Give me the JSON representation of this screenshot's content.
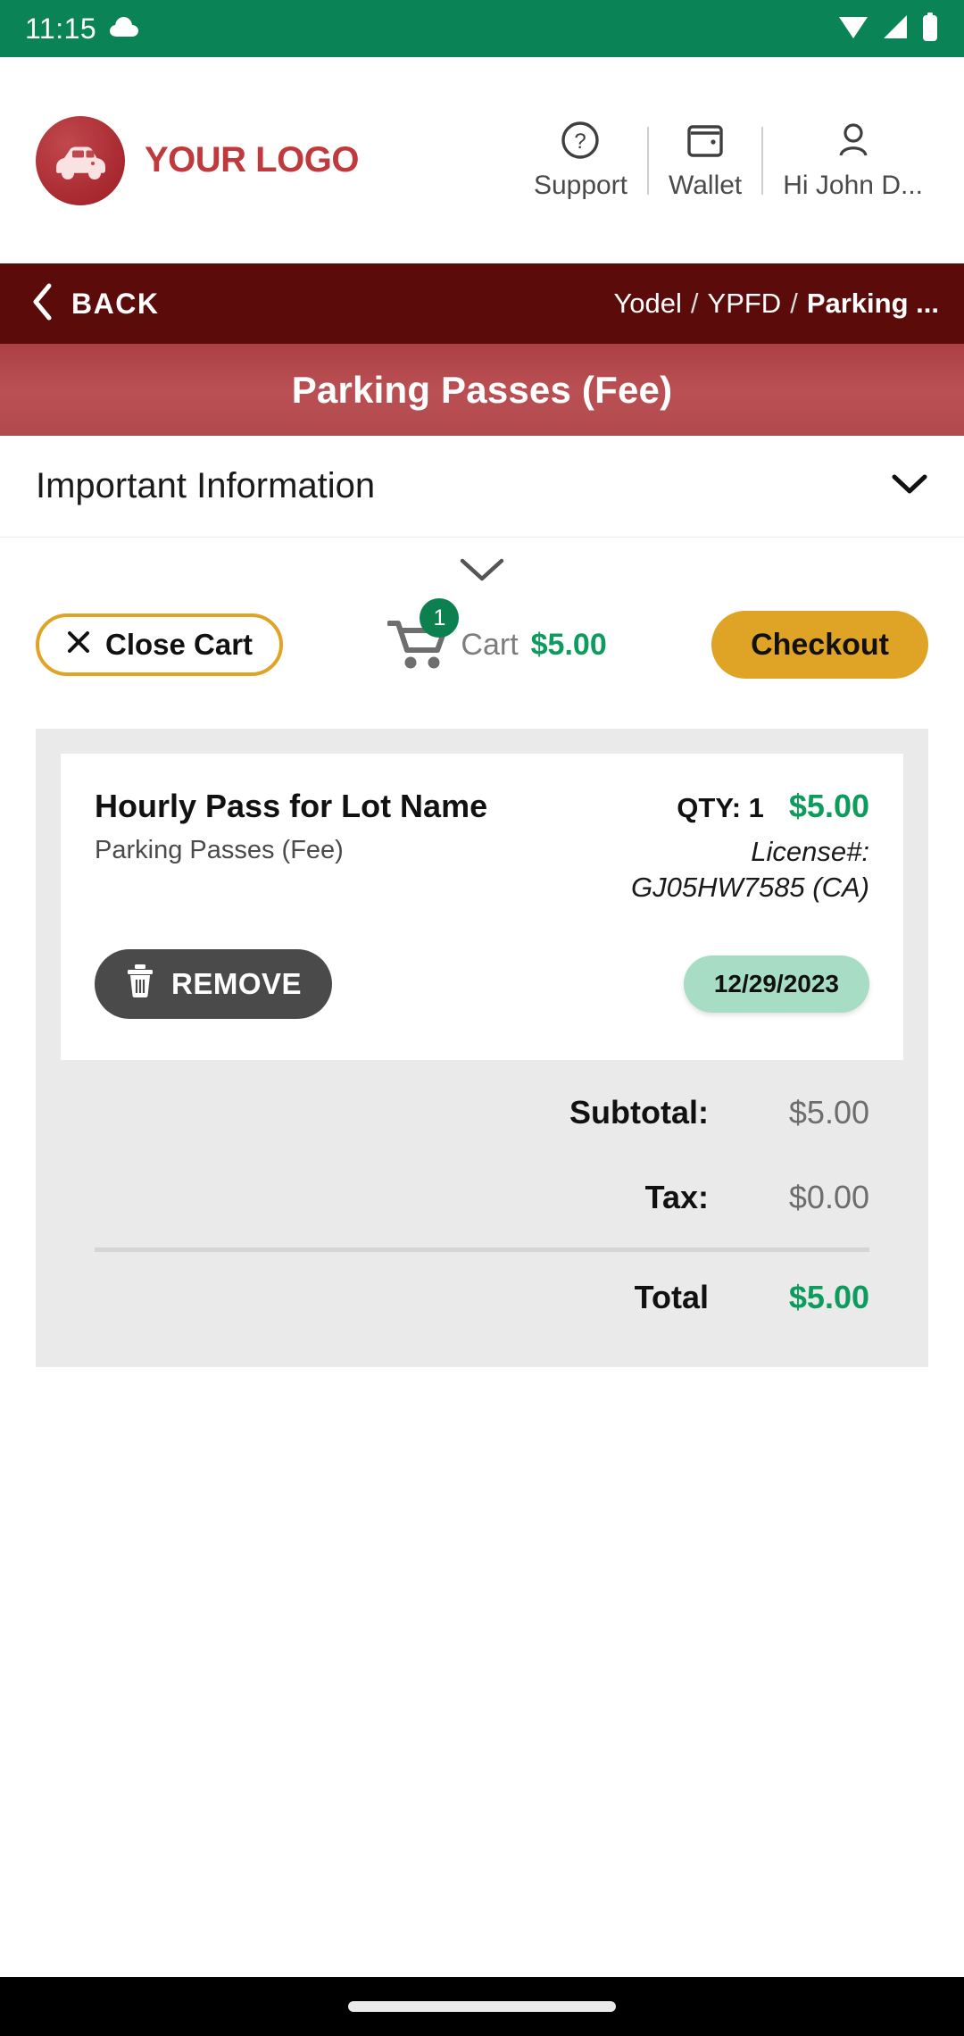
{
  "status_bar": {
    "time": "11:15",
    "weather_icon": "cloud-icon",
    "wifi_icon": "wifi-icon",
    "signal_icon": "cellular-signal-icon",
    "battery_icon": "battery-icon",
    "background_color": "#0a8457"
  },
  "header": {
    "logo_text": "YOUR LOGO",
    "logo_icon": "car-logo-icon",
    "logo_color": "#c0393d",
    "nav": [
      {
        "label": "Support",
        "icon": "question-circle-icon"
      },
      {
        "label": "Wallet",
        "icon": "wallet-icon"
      },
      {
        "label": "Hi John D...",
        "icon": "user-account-icon"
      }
    ]
  },
  "breadcrumb_bar": {
    "back_label": "BACK",
    "back_icon": "chevron-left-icon",
    "background_color": "#5c0b0b",
    "crumbs": [
      {
        "label": "Yodel",
        "active": false
      },
      {
        "label": "YPFD",
        "active": false
      },
      {
        "label": "Parking ...",
        "active": true
      }
    ],
    "separator": "/"
  },
  "page_title": {
    "text": "Parking Passes (Fee)",
    "background_color": "#b04a4e"
  },
  "important_information": {
    "title": "Important Information",
    "chevron_icon": "chevron-down-icon"
  },
  "collapse_toggle": {
    "icon": "chevron-down-icon"
  },
  "cart_bar": {
    "close_cart_label": "Close Cart",
    "close_cart_icon": "close-x-icon",
    "cart_icon": "shopping-cart-icon",
    "cart_badge_count": "1",
    "cart_word": "Cart",
    "cart_total": "$5.00",
    "checkout_label": "Checkout",
    "accent_color": "#dfa425",
    "money_color": "#0d9b5e"
  },
  "cart": {
    "item": {
      "name": "Hourly Pass for Lot Name",
      "category": "Parking Passes (Fee)",
      "qty": "QTY: 1",
      "price": "$5.00",
      "license_label": "License#:",
      "license_value": "GJ05HW7585 (CA)",
      "remove_label": "REMOVE",
      "remove_icon": "trash-icon",
      "date": "12/29/2023"
    },
    "totals": [
      {
        "label": "Subtotal:",
        "value": "$5.00"
      },
      {
        "label": "Tax:",
        "value": "$0.00"
      }
    ],
    "grand_total": {
      "label": "Total",
      "value": "$5.00"
    }
  }
}
